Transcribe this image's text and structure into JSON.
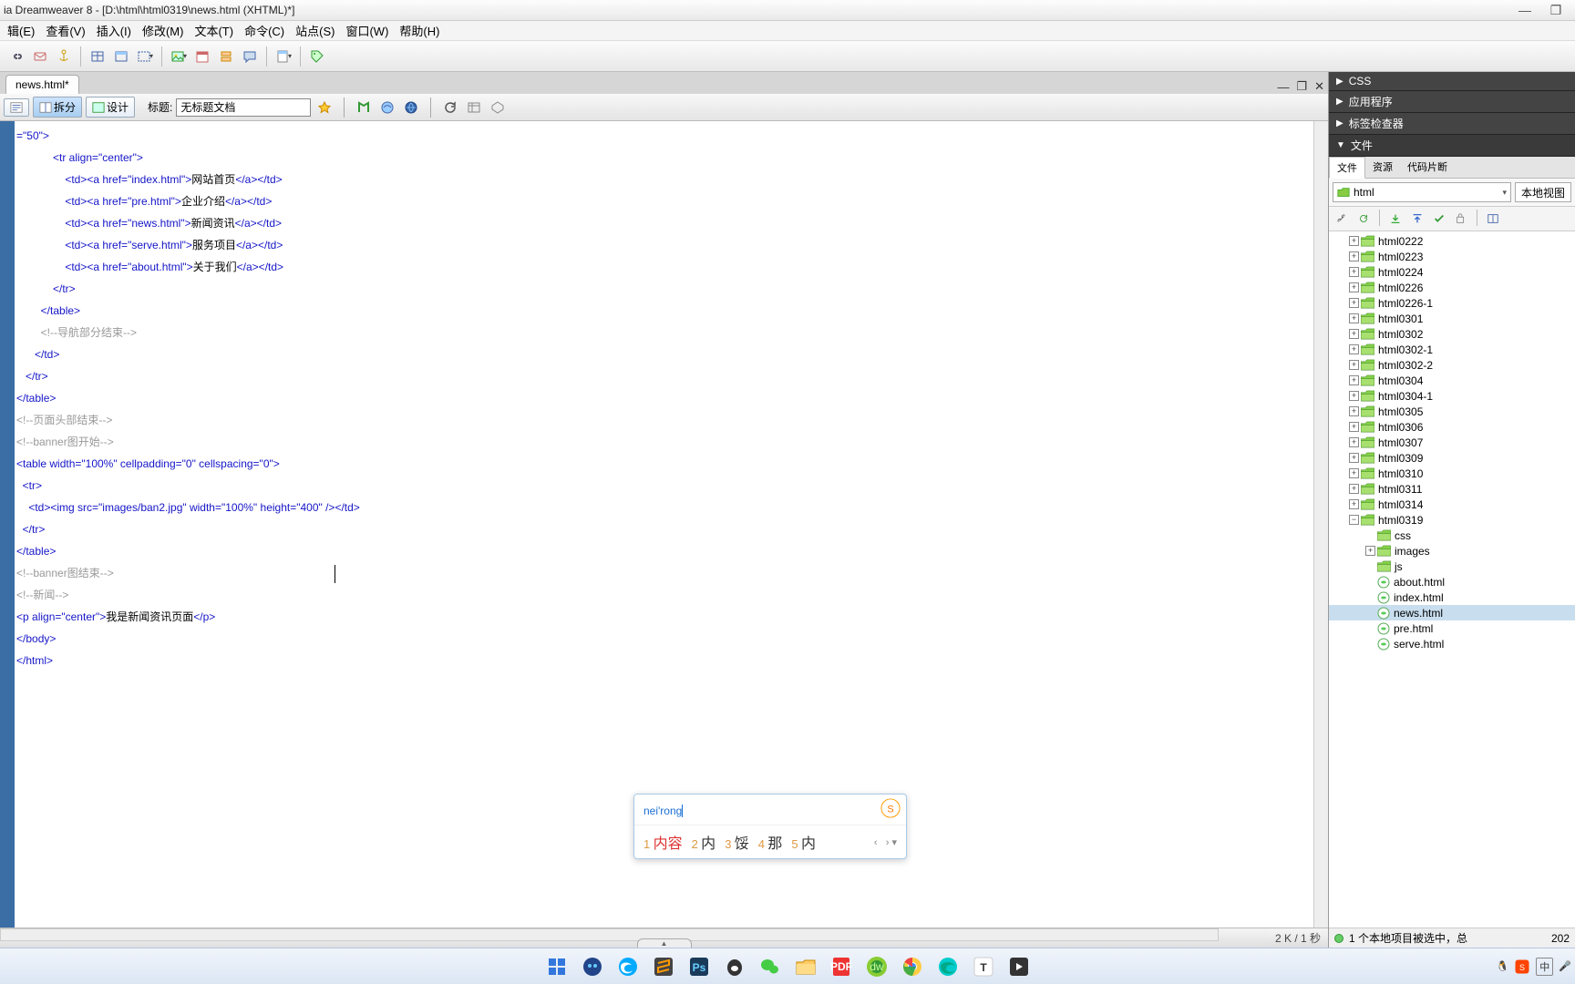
{
  "title": "ia Dreamweaver 8 - [D:\\html\\html0319\\news.html (XHTML)*]",
  "window_controls": {
    "min": "—",
    "max": "❐",
    "close": ""
  },
  "menus": [
    "辑(E)",
    "查看(V)",
    "插入(I)",
    "修改(M)",
    "文本(T)",
    "命令(C)",
    "站点(S)",
    "窗口(W)",
    "帮助(H)"
  ],
  "doc_tab": "news.html*",
  "doc_controls": {
    "min": "—",
    "restore": "❐",
    "close": "✕"
  },
  "view_buttons": {
    "split": "拆分",
    "design": "设计"
  },
  "title_label": "标题:",
  "title_value": "无标题文档",
  "code_lines": [
    {
      "t": "tag",
      "text": "=\"50\">"
    },
    {
      "t": "tag",
      "text": "            <tr align=\"center\">"
    },
    {
      "t": "mixed",
      "parts": [
        {
          "c": "tag",
          "s": "                <td><a href=\"index.html\">"
        },
        {
          "c": "txt",
          "s": "网站首页"
        },
        {
          "c": "tag",
          "s": "</a></td>"
        }
      ]
    },
    {
      "t": "mixed",
      "parts": [
        {
          "c": "tag",
          "s": "                <td><a href=\"pre.html\">"
        },
        {
          "c": "txt",
          "s": "企业介绍"
        },
        {
          "c": "tag",
          "s": "</a></td>"
        }
      ]
    },
    {
      "t": "mixed",
      "parts": [
        {
          "c": "tag",
          "s": "                <td><a href=\"news.html\">"
        },
        {
          "c": "txt",
          "s": "新闻资讯"
        },
        {
          "c": "tag",
          "s": "</a></td>"
        }
      ]
    },
    {
      "t": "mixed",
      "parts": [
        {
          "c": "tag",
          "s": "                <td><a href=\"serve.html\">"
        },
        {
          "c": "txt",
          "s": "服务项目"
        },
        {
          "c": "tag",
          "s": "</a></td>"
        }
      ]
    },
    {
      "t": "mixed",
      "parts": [
        {
          "c": "tag",
          "s": "                <td><a href=\"about.html\">"
        },
        {
          "c": "txt",
          "s": "关于我们"
        },
        {
          "c": "tag",
          "s": "</a></td>"
        }
      ]
    },
    {
      "t": "tag",
      "text": "            </tr>"
    },
    {
      "t": "tag",
      "text": "        </table>"
    },
    {
      "t": "cmt",
      "text": "        <!--导航部分结束-->"
    },
    {
      "t": "tag",
      "text": "      </td>"
    },
    {
      "t": "tag",
      "text": "   </tr>"
    },
    {
      "t": "tag",
      "text": "</table>"
    },
    {
      "t": "cmt",
      "text": "<!--页面头部结束-->"
    },
    {
      "t": "cmt",
      "text": "<!--banner图开始-->"
    },
    {
      "t": "tag",
      "text": "<table width=\"100%\" cellpadding=\"0\" cellspacing=\"0\">"
    },
    {
      "t": "tag",
      "text": "  <tr>"
    },
    {
      "t": "tag",
      "text": "    <td><img src=\"images/ban2.jpg\" width=\"100%\" height=\"400\" /></td>"
    },
    {
      "t": "tag",
      "text": "  </tr>"
    },
    {
      "t": "tag",
      "text": "</table>"
    },
    {
      "t": "mixed",
      "parts": [
        {
          "c": "cmt",
          "s": "<!--banner图结束-->"
        },
        {
          "c": "cursor",
          "s": ""
        }
      ]
    },
    {
      "t": "cmt",
      "text": "<!--新闻-->"
    },
    {
      "t": "mixed",
      "parts": [
        {
          "c": "tag",
          "s": "<p align=\"center\">"
        },
        {
          "c": "txt",
          "s": "我是新闻资讯页面"
        },
        {
          "c": "tag",
          "s": "</p>"
        }
      ]
    },
    {
      "t": "tag",
      "text": "</body>"
    },
    {
      "t": "tag",
      "text": "</html>"
    }
  ],
  "status": {
    "size": "2 K / 1 秒"
  },
  "panels": {
    "css": "CSS",
    "app": "应用程序",
    "tag": "标签检查器",
    "files": "文件"
  },
  "file_tabs": [
    "文件",
    "资源",
    "代码片断"
  ],
  "site_select": "html",
  "view_select": "本地视图",
  "tree": [
    {
      "lvl": 1,
      "exp": "+",
      "type": "folder",
      "name": "html0222"
    },
    {
      "lvl": 1,
      "exp": "+",
      "type": "folder",
      "name": "html0223"
    },
    {
      "lvl": 1,
      "exp": "+",
      "type": "folder",
      "name": "html0224"
    },
    {
      "lvl": 1,
      "exp": "+",
      "type": "folder",
      "name": "html0226"
    },
    {
      "lvl": 1,
      "exp": "+",
      "type": "folder",
      "name": "html0226-1"
    },
    {
      "lvl": 1,
      "exp": "+",
      "type": "folder",
      "name": "html0301"
    },
    {
      "lvl": 1,
      "exp": "+",
      "type": "folder",
      "name": "html0302"
    },
    {
      "lvl": 1,
      "exp": "+",
      "type": "folder",
      "name": "html0302-1"
    },
    {
      "lvl": 1,
      "exp": "+",
      "type": "folder",
      "name": "html0302-2"
    },
    {
      "lvl": 1,
      "exp": "+",
      "type": "folder",
      "name": "html0304"
    },
    {
      "lvl": 1,
      "exp": "+",
      "type": "folder",
      "name": "html0304-1"
    },
    {
      "lvl": 1,
      "exp": "+",
      "type": "folder",
      "name": "html0305"
    },
    {
      "lvl": 1,
      "exp": "+",
      "type": "folder",
      "name": "html0306"
    },
    {
      "lvl": 1,
      "exp": "+",
      "type": "folder",
      "name": "html0307"
    },
    {
      "lvl": 1,
      "exp": "+",
      "type": "folder",
      "name": "html0309"
    },
    {
      "lvl": 1,
      "exp": "+",
      "type": "folder",
      "name": "html0310"
    },
    {
      "lvl": 1,
      "exp": "+",
      "type": "folder",
      "name": "html0311"
    },
    {
      "lvl": 1,
      "exp": "+",
      "type": "folder",
      "name": "html0314"
    },
    {
      "lvl": 1,
      "exp": "-",
      "type": "folder",
      "name": "html0319"
    },
    {
      "lvl": 2,
      "exp": "",
      "type": "folder",
      "name": "css"
    },
    {
      "lvl": 2,
      "exp": "+",
      "type": "folder",
      "name": "images"
    },
    {
      "lvl": 2,
      "exp": "",
      "type": "folder",
      "name": "js"
    },
    {
      "lvl": 2,
      "exp": "",
      "type": "file",
      "name": "about.html"
    },
    {
      "lvl": 2,
      "exp": "",
      "type": "file",
      "name": "index.html"
    },
    {
      "lvl": 2,
      "exp": "",
      "type": "file",
      "name": "news.html",
      "sel": true
    },
    {
      "lvl": 2,
      "exp": "",
      "type": "file",
      "name": "pre.html"
    },
    {
      "lvl": 2,
      "exp": "",
      "type": "file",
      "name": "serve.html"
    }
  ],
  "right_status": "1 个本地项目被选中，总",
  "right_status_time": "202",
  "ime": {
    "input": "nei'rong",
    "candidates": [
      {
        "n": "1",
        "w": "内容",
        "sel": true
      },
      {
        "n": "2",
        "w": "内"
      },
      {
        "n": "3",
        "w": "馁"
      },
      {
        "n": "4",
        "w": "那"
      },
      {
        "n": "5",
        "w": "内"
      }
    ]
  },
  "taskbar_time": ""
}
